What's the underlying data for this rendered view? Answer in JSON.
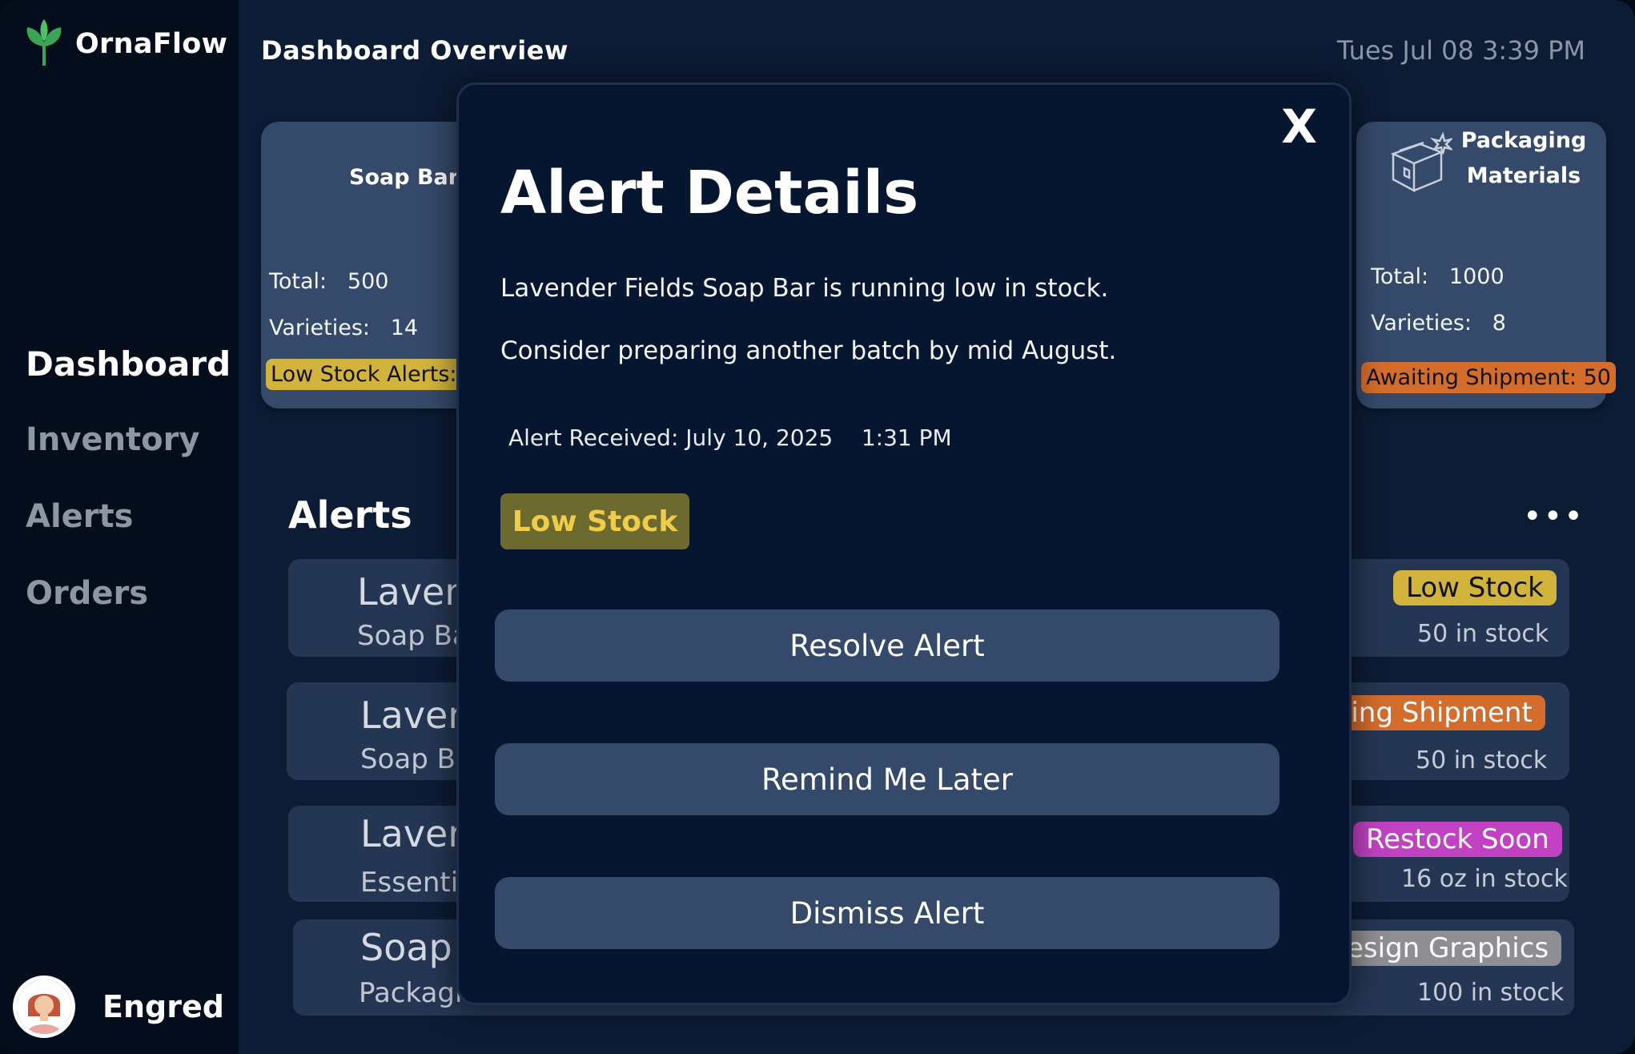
{
  "app": {
    "name": "OrnaFlow",
    "page_title": "Dashboard Overview",
    "datetime": "Tues Jul 08 3:39 PM"
  },
  "sidebar": {
    "items": [
      {
        "label": "Dashboard",
        "active": true
      },
      {
        "label": "Inventory"
      },
      {
        "label": "Alerts"
      },
      {
        "label": "Orders"
      }
    ],
    "user_name": "Engred"
  },
  "cards": [
    {
      "label": "Soap Bars",
      "total_label": "Total:",
      "total": "500",
      "varieties_label": "Varieties:",
      "varieties": "14",
      "badge": "Low Stock Alerts:"
    },
    {
      "label": "Packaging Materials",
      "total_label": "Total:",
      "total": "1000",
      "varieties_label": "Varieties:",
      "varieties": "8",
      "badge": "Awaiting Shipment: 50"
    }
  ],
  "alerts": {
    "title": "Alerts",
    "more": "•••",
    "rows": [
      {
        "title": "Laven",
        "subtitle": "Soap Ba",
        "badge": "Low Stock",
        "stock": "50 in stock"
      },
      {
        "title": "Laver",
        "subtitle": "Soap B",
        "badge": "ting Shipment",
        "stock": "50 in stock"
      },
      {
        "title": "Laver",
        "subtitle": "Essenti",
        "badge": "Restock Soon",
        "stock": "16 oz in stock"
      },
      {
        "title": "Soap",
        "subtitle": "Packagi",
        "badge": "esign Graphics",
        "stock": "100 in stock"
      }
    ]
  },
  "modal": {
    "close": "X",
    "title": "Alert Details",
    "message_1": "Lavender Fields Soap Bar is running low in stock.",
    "message_2": "Consider preparing another batch by mid August.",
    "received": "Alert Received: July 10, 2025    1:31 PM",
    "tag": "Low Stock",
    "buttons": {
      "resolve": "Resolve Alert",
      "remind": "Remind Me Later",
      "dismiss": "Dismiss Alert"
    }
  },
  "colors": {
    "low_stock_badge": "#d2b43c",
    "awaiting_shipment_badge": "#d46c2c",
    "restock_soon_badge": "#c241c2",
    "design_graphics_badge": "#8e8f92",
    "modal_tag_bg": "#6c6a2f",
    "modal_tag_text": "#f1cc48"
  }
}
